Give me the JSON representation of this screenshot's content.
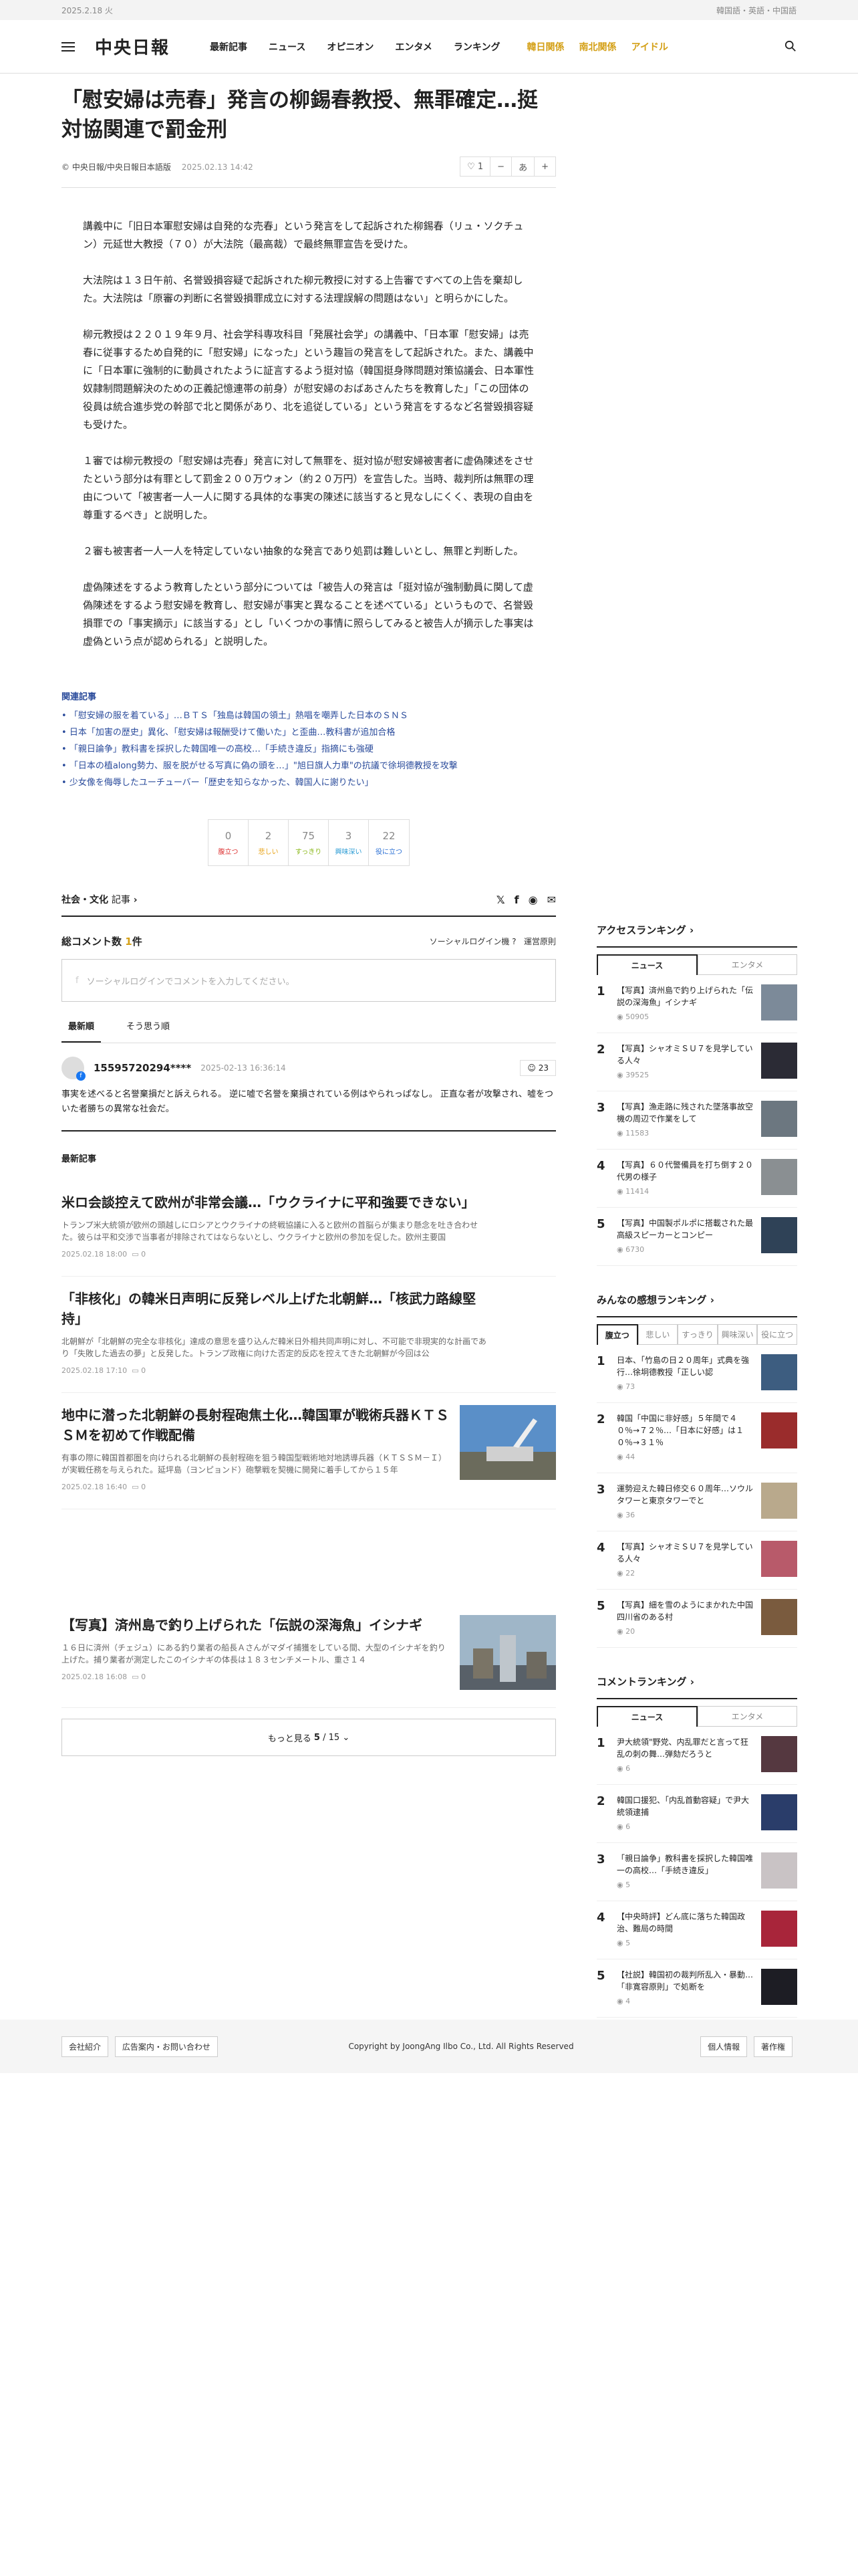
{
  "topbar": {
    "date": "2025.2.18 火",
    "langs": "韓国語・英語・中国語"
  },
  "header": {
    "logo": "中央日報",
    "nav": [
      "最新記事",
      "ニュース",
      "オピニオン",
      "エンタメ",
      "ランキング"
    ],
    "nav_special": [
      "韓日関係",
      "南北関係",
      "アイドル"
    ]
  },
  "article": {
    "title": "「慰安婦は売春」発言の柳錫春教授、無罪確定…挺対協関連で罰金刑",
    "source": "中央日報/中央日報日本語版",
    "date": "2025.02.13 14:42",
    "like_count": "1",
    "font_label": "あ",
    "paragraphs": [
      "講義中に「旧日本軍慰安婦は自発的な売春」という発言をして起訴された柳錫春（リュ・ソクチュン）元延世大教授（７０）が大法院（最高裁）で最終無罪宣告を受けた。",
      "大法院は１３日午前、名誉毀損容疑で起訴された柳元教授に対する上告審ですべての上告を棄却した。大法院は「原審の判断に名誉毀損罪成立に対する法理誤解の問題はない」と明らかにした。",
      "柳元教授は２２０１９年９月、社会学科専攻科目「発展社会学」の講義中、「日本軍「慰安婦」は売春に従事するため自発的に「慰安婦」になった」という趣旨の発言をして起訴された。また、講義中に「日本軍に強制的に動員されたように証言するよう挺対協（韓国挺身隊問題対策協議会、日本軍性奴隷制問題解決のための正義記憶連帯の前身）が慰安婦のおばあさんたちを教育した」「この団体の役員は統合進歩党の幹部で北と関係があり、北を追従している」という発言をするなど名誉毀損容疑も受けた。",
      "１審では柳元教授の「慰安婦は売春」発言に対して無罪を、挺対協が慰安婦被害者に虚偽陳述をさせたという部分は有罪として罰金２００万ウォン（約２０万円）を宣告した。当時、裁判所は無罪の理由について「被害者一人一人に関する具体的な事実の陳述に該当すると見なしにくく、表現の自由を尊重するべき」と説明した。",
      "２審も被害者一人一人を特定していない抽象的な発言であり処罰は難しいとし、無罪と判断した。",
      "虚偽陳述をするよう教育したという部分については「被告人の発言は「挺対協が強制動員に関して虚偽陳述をするよう慰安婦を教育し、慰安婦が事実と異なることを述べている」というもので、名誉毀損罪での「事実摘示」に該当する」とし「いくつかの事情に照らしてみると被告人が摘示した事実は虚偽という点が認められる」と説明した。"
    ]
  },
  "related": {
    "heading": "関連記事",
    "items": [
      "「慰安婦の服を着ている」…ＢＴＳ「独島は韓国の領土」熱唱を嘲弄した日本のＳＮＳ",
      "日本「加害の歴史」異化、「慰安婦は報酬受けて働いた」と歪曲…教科書が追加合格",
      "「親日論争」教科書を採択した韓国唯一の高校…「手続き違反」指摘にも強硬",
      "「日本の植along勢力、服を脱がせる写真に偽の頭を…」\"旭日旗人力車\"の抗議で徐坰德教授を攻撃",
      "少女像を侮辱したユーチューバー「歴史を知らなかった、韓国人に謝りたい」"
    ]
  },
  "reactions": [
    {
      "n": "0",
      "l": "腹立つ",
      "c": "#d33"
    },
    {
      "n": "2",
      "l": "悲しい",
      "c": "#e8a317"
    },
    {
      "n": "75",
      "l": "すっきり",
      "c": "#8ab818"
    },
    {
      "n": "3",
      "l": "興味深い",
      "c": "#2a9bd4"
    },
    {
      "n": "22",
      "l": "役に立つ",
      "c": "#2a6fd4"
    }
  ],
  "category": {
    "label": "社会・文化",
    "suffix": "記事"
  },
  "comments": {
    "heading": "総コメント数",
    "count": "1",
    "unit": "件",
    "social_login": "ソーシャルログイン機",
    "policy": "運営原則",
    "placeholder": "ソーシャルログインでコメントを入力してください。",
    "tab_new": "最新順",
    "tab_agree": "そう思う順",
    "item": {
      "user": "15595720294****",
      "date": "2025-02-13 16:36:14",
      "likes": "23",
      "text": "事実を述べると名誉棄損だと訴えられる。 逆に嘘で名誉を棄損されている例はやられっぱなし。 正直な者が攻撃され、嘘をついた者勝ちの異常な社会だ。"
    }
  },
  "latest": {
    "heading": "最新記事",
    "items": [
      {
        "title": "米ロ会談控えて欧州が非常会議…「ウクライナに平和強要できない」",
        "summary": "トランプ米大統領が欧州の頭越しにロシアとウクライナの終戦協議に入ると欧州の首脳らが集まり懸念を吐き合わせた。彼らは平和交渉で当事者が排除されてはならないとし、ウクライナと欧州の参加を促した。欧州主要国",
        "date": "2025.02.18 18:00",
        "count": "0",
        "img": false
      },
      {
        "title": "「非核化」の韓米日声明に反発レベル上げた北朝鮮…「核武力路線堅持」",
        "summary": "北朝鮮が「北朝鮮の完全な非核化」達成の意思を盛り込んだ韓米日外相共同声明に対し、不可能で非現実的な計画であり「失敗した過去の夢」と反発した。トランプ政権に向けた否定的反応を控えてきた北朝鮮が今回は公",
        "date": "2025.02.18 17:10",
        "count": "0",
        "img": false
      },
      {
        "title": "地中に潜った北朝鮮の長射程砲焦土化…韓国軍が戦術兵器ＫＴＳＳＭを初めて作戦配備",
        "summary": "有事の際に韓国首都圏を向けられる北朝鮮の長射程砲を狙う韓国型戦術地対地誘導兵器（ＫＴＳＳＭ－Ｉ）が実戦任務を与えられた。延坪島（ヨンピョンド）砲撃戦を契機に開発に着手してから１５年",
        "date": "2025.02.18 16:40",
        "count": "0",
        "img": true
      },
      {
        "title": "【写真】済州島で釣り上げられた「伝説の深海魚」イシナギ",
        "summary": "１６日に済州（チェジュ）にある釣り業者の船長Ａさんがマダイ捕獲をしている間、大型のイシナギを釣り上げた。捕り業者が測定したこのイシナギの体長は１８３センチメートル、重さ１４",
        "date": "2025.02.18 16:08",
        "count": "0",
        "img": true
      }
    ],
    "more": "もっと見る",
    "page": "5",
    "total": "15"
  },
  "access_ranking": {
    "heading": "アクセスランキング",
    "tabs": [
      "ニュース",
      "エンタメ"
    ],
    "items": [
      {
        "n": "1",
        "t": "【写真】済州島で釣り上げられた「伝説の深海魚」イシナギ",
        "c": "50905"
      },
      {
        "n": "2",
        "t": "【写真】シャオミＳＵ７を見学している人々",
        "c": "39525"
      },
      {
        "n": "3",
        "t": "【写真】漁走路に残された墜落事故空機の周辺で作業をして",
        "c": "11583"
      },
      {
        "n": "4",
        "t": "【写真】６０代警備員を打ち倒す２０代男の様子",
        "c": "11414"
      },
      {
        "n": "5",
        "t": "【写真】中国製ポルポに搭載された最高級スピーカーとコンピー",
        "c": "6730"
      }
    ]
  },
  "emotion_ranking": {
    "heading": "みんなの感想ランキング",
    "tabs": [
      "腹立つ",
      "悲しい",
      "すっきり",
      "興味深い",
      "役に立つ"
    ],
    "items": [
      {
        "n": "1",
        "t": "日本、「竹島の日２０周年」式典を強行…徐坰德教授「正しい認",
        "c": "73"
      },
      {
        "n": "2",
        "t": "韓国「中国に非好感」５年間で４０％→７２％…「日本に好感」は１０％→３１％",
        "c": "44"
      },
      {
        "n": "3",
        "t": "運勢迎えた韓日修交６０周年…ソウルタワーと東京タワーでと",
        "c": "36"
      },
      {
        "n": "4",
        "t": "【写真】シャオミＳＵ７を見学している人々",
        "c": "22"
      },
      {
        "n": "5",
        "t": "【写真】細を雪のようにまかれた中国四川省のある村",
        "c": "20"
      }
    ]
  },
  "comment_ranking": {
    "heading": "コメントランキング",
    "tabs": [
      "ニュース",
      "エンタメ"
    ],
    "items": [
      {
        "n": "1",
        "t": "尹大統領\"野党、内乱罪だと言って狂乱の刺の舞…弾劾だろうと",
        "c": "6"
      },
      {
        "n": "2",
        "t": "韓国口援犯、「内乱首動容疑」で尹大統領逮捕",
        "c": "6"
      },
      {
        "n": "3",
        "t": "「親日論争」教科書を採択した韓国唯一の高校…「手続き違反」",
        "c": "5"
      },
      {
        "n": "4",
        "t": "【中央時評】どん底に落ちた韓国政治、難局の時間",
        "c": "5"
      },
      {
        "n": "5",
        "t": "【社説】韓国初の裁判所乱入・暴動…「非寛容原則」で処断を",
        "c": "4"
      }
    ]
  },
  "footer": {
    "left": [
      "会社紹介",
      "広告案内・お問い合わせ"
    ],
    "copy": "Copyright by JoongAng Ilbo Co., Ltd. All Rights Reserved",
    "right": [
      "個人情報",
      "著作権"
    ]
  }
}
